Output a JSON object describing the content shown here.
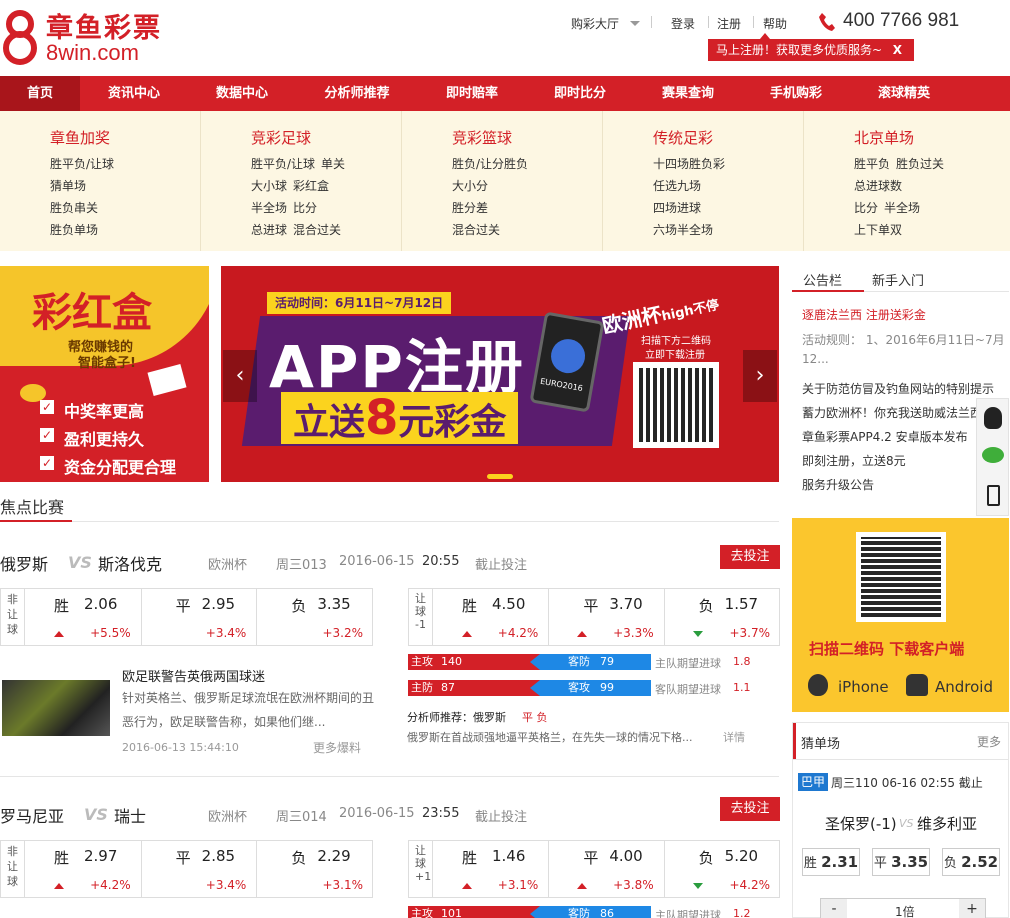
{
  "header": {
    "logo_cn": "章鱼彩票",
    "logo_en": "8win.com",
    "buy_hall": "购彩大厅",
    "login": "登录",
    "register": "注册",
    "help": "帮助",
    "phone": "400 7766 981",
    "reg_tip": "马上注册！获取更多优质服务~",
    "reg_tip_close": "X"
  },
  "nav": [
    "首页",
    "资讯中心",
    "数据中心",
    "分析师推荐",
    "即时赔率",
    "即时比分",
    "赛果查询",
    "手机购彩",
    "滚球精英"
  ],
  "submenu": [
    {
      "title": "章鱼加奖",
      "links": [
        "胜平负/让球",
        "猜单场",
        "胜负串关",
        "胜负单场"
      ]
    },
    {
      "title": "竞彩足球",
      "links": [
        "胜平负/让球",
        "单关",
        "大小球",
        "彩红盒",
        "半全场",
        "比分",
        "总进球",
        "混合过关"
      ]
    },
    {
      "title": "竞彩篮球",
      "links": [
        "胜负/让分胜负",
        "大小分",
        "胜分差",
        "混合过关"
      ]
    },
    {
      "title": "传统足彩",
      "links": [
        "十四场胜负彩",
        "任选九场",
        "四场进球",
        "六场半全场"
      ]
    },
    {
      "title": "北京单场",
      "links": [
        "胜平负",
        "胜负过关",
        "总进球数",
        "比分",
        "半全场",
        "上下单双"
      ]
    }
  ],
  "caihonghe": {
    "title": "彩红盒",
    "slogan1": "帮您赚钱的",
    "slogan2": "智能盒子!",
    "points": [
      "中奖率更高",
      "盈利更持久",
      "资金分配更合理"
    ]
  },
  "banner": {
    "time": "活动时间：6月11日~7月12日",
    "headline": "APP注册",
    "sub1": "立送",
    "sub_num": "8",
    "sub2": "元彩金",
    "euro": "欧洲杯",
    "euro_high": "high不停",
    "scan1": "扫描下方二维码",
    "scan2": "立即下载注册",
    "euro_logo": "EURO2016"
  },
  "sidebar": {
    "tabs": [
      "公告栏",
      "新手入门"
    ],
    "notices": [
      {
        "text": "逐鹿法兰西  注册送彩金",
        "color": "#d32027"
      },
      {
        "text": "活动规则： 1、2016年6月11日~7月",
        "color": "#888"
      },
      {
        "text": "12...",
        "color": "#888"
      },
      {
        "text": "关于防范仿冒及钓鱼网站的特别提示",
        "color": "#333"
      },
      {
        "text": "蓄力欧洲杯！你充我送助威法兰西",
        "color": "#333"
      },
      {
        "text": "章鱼彩票APP4.2 安卓版本发布",
        "color": "#333"
      },
      {
        "text": "即刻注册，立送8元",
        "color": "#333"
      },
      {
        "text": "服务升级公告",
        "color": "#333"
      }
    ],
    "qr_text": "扫描二维码 下载客户端",
    "iphone": "iPhone",
    "android": "Android",
    "guess": {
      "title": "猜单场",
      "more": "更多",
      "league": "巴甲",
      "info": "周三110 06-16 02:55 截止",
      "home": "圣保罗(-1)",
      "vs": "VS",
      "away": "维多利亚",
      "opts": [
        {
          "k": "胜",
          "v": "2.31"
        },
        {
          "k": "平",
          "v": "3.35"
        },
        {
          "k": "负",
          "v": "2.52"
        }
      ],
      "times": "1倍",
      "minus": "-",
      "plus": "+"
    }
  },
  "focus": {
    "title": "焦点比赛",
    "matches": [
      {
        "home": "俄罗斯",
        "vs": "VS",
        "away": "斯洛伐克",
        "league": "欧洲杯",
        "code": "周三013",
        "date": "2016-06-15",
        "time": "20:55",
        "status": "截止投注",
        "bet": "去投注",
        "odds1": {
          "side": "非让球",
          "w": "2.06",
          "d": "2.95",
          "l": "3.35",
          "wc": "+5.5%",
          "dc": "+3.4%",
          "lc": "+3.2%"
        },
        "odds2": {
          "side": "让球",
          "hc": "-1",
          "w": "4.50",
          "d": "3.70",
          "l": "1.57",
          "wc": "+4.2%",
          "dc": "+3.3%",
          "lc": "+3.7%"
        },
        "bars": [
          {
            "a": "主攻",
            "av": "140",
            "b": "客防",
            "bv": "79",
            "exp": "主队期望进球",
            "ev": "1.8"
          },
          {
            "a": "主防",
            "av": "87",
            "b": "客攻",
            "bv": "99",
            "exp": "客队期望进球",
            "ev": "1.1"
          }
        ],
        "analyst": "分析师推荐：俄罗斯",
        "pick": "平 负",
        "analysis": "俄罗斯在首战顽强地逼平英格兰，在先失一球的情况下格...",
        "detail": "详情",
        "news_title": "欧足联警告英俄两国球迷",
        "news_text1": "针对英格兰、俄罗斯足球流氓在欧洲杯期间的丑",
        "news_text2": "恶行为，欧足联警告称，如果他们继...",
        "news_date": "2016-06-13 15:44:10",
        "news_more": "更多爆料"
      },
      {
        "home": "罗马尼亚",
        "vs": "VS",
        "away": "瑞士",
        "league": "欧洲杯",
        "code": "周三014",
        "date": "2016-06-15",
        "time": "23:55",
        "status": "截止投注",
        "bet": "去投注",
        "odds1": {
          "side": "非让球",
          "w": "2.97",
          "d": "2.85",
          "l": "2.29",
          "wc": "+4.2%",
          "dc": "+3.4%",
          "lc": "+3.1%"
        },
        "odds2": {
          "side": "让球",
          "hc": "+1",
          "w": "1.46",
          "d": "4.00",
          "l": "5.20",
          "wc": "+3.1%",
          "dc": "+3.8%",
          "lc": "+4.2%"
        },
        "bars": [
          {
            "a": "主攻",
            "av": "101",
            "b": "客防",
            "bv": "86",
            "exp": "主队期望进球",
            "ev": "1.2"
          }
        ]
      }
    ],
    "labels": {
      "w": "胜",
      "d": "平",
      "l": "负"
    }
  }
}
